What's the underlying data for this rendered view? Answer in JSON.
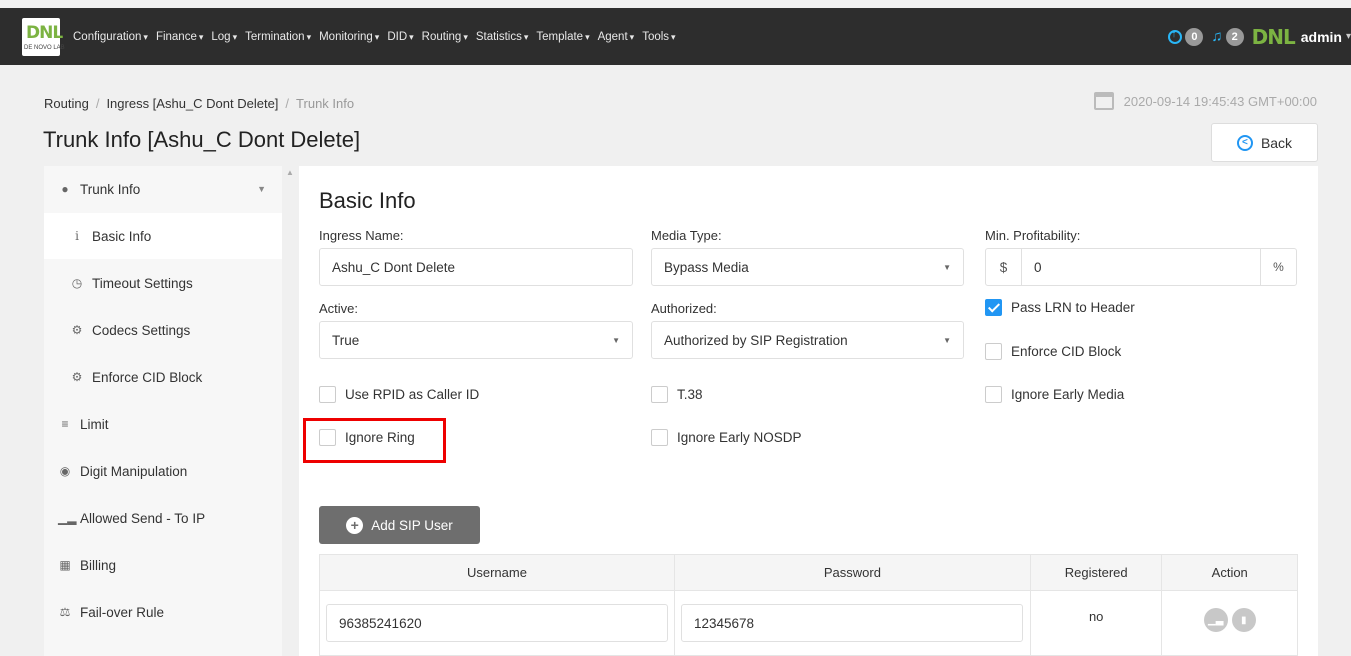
{
  "app": {
    "logo_text": "DNL",
    "logo_sub": "DE NOVO LAB",
    "nav": [
      {
        "label": "Configuration"
      },
      {
        "label": "Finance"
      },
      {
        "label": "Log"
      },
      {
        "label": "Termination"
      },
      {
        "label": "Monitoring"
      },
      {
        "label": "DID"
      },
      {
        "label": "Routing"
      },
      {
        "label": "Statistics"
      },
      {
        "label": "Template"
      },
      {
        "label": "Agent"
      },
      {
        "label": "Tools"
      }
    ],
    "upload_count": "0",
    "notification_count": "2",
    "mini_logo": "DNL",
    "user": "admin"
  },
  "breadcrumb": {
    "items": [
      "Routing",
      "Ingress [Ashu_C Dont Delete]",
      "Trunk Info"
    ]
  },
  "timestamp": "2020-09-14 19:45:43 GMT+00:00",
  "page_title": "Trunk Info [Ashu_C Dont Delete]",
  "back_label": "Back",
  "sidebar": {
    "items": [
      {
        "label": "Trunk Info",
        "icon": "info-circle-icon"
      },
      {
        "label": "Basic Info",
        "icon": "info-icon"
      },
      {
        "label": "Timeout Settings",
        "icon": "clock-icon"
      },
      {
        "label": "Codecs Settings",
        "icon": "gears-icon"
      },
      {
        "label": "Enforce CID Block",
        "icon": "gears-icon"
      },
      {
        "label": "Limit",
        "icon": "database-icon"
      },
      {
        "label": "Digit Manipulation",
        "icon": "play-circle-icon"
      },
      {
        "label": "Allowed Send - To IP",
        "icon": "signal-icon"
      },
      {
        "label": "Billing",
        "icon": "calendar-icon"
      },
      {
        "label": "Fail-over Rule",
        "icon": "balance-scale-icon"
      }
    ]
  },
  "form": {
    "section_title": "Basic Info",
    "ingress_name_label": "Ingress Name:",
    "ingress_name_value": "Ashu_C Dont Delete",
    "media_type_label": "Media Type:",
    "media_type_value": "Bypass Media",
    "min_profit_label": "Min. Profitability:",
    "min_profit_prefix": "$",
    "min_profit_value": "0",
    "min_profit_suffix": "%",
    "active_label": "Active:",
    "active_value": "True",
    "authorized_label": "Authorized:",
    "authorized_value": "Authorized by SIP Registration",
    "pass_lrn_label": "Pass LRN to Header",
    "pass_lrn_checked": true,
    "enforce_cid_label": "Enforce CID Block",
    "use_rpid_label": "Use RPID as Caller ID",
    "t38_label": "T.38",
    "ignore_early_media_label": "Ignore Early Media",
    "ignore_ring_label": "Ignore Ring",
    "ignore_early_nosdp_label": "Ignore Early NOSDP"
  },
  "sip": {
    "add_label": "Add SIP User",
    "columns": [
      "Username",
      "Password",
      "Registered",
      "Action"
    ],
    "rows": [
      {
        "username": "96385241620",
        "password": "12345678",
        "registered": "no"
      }
    ]
  }
}
